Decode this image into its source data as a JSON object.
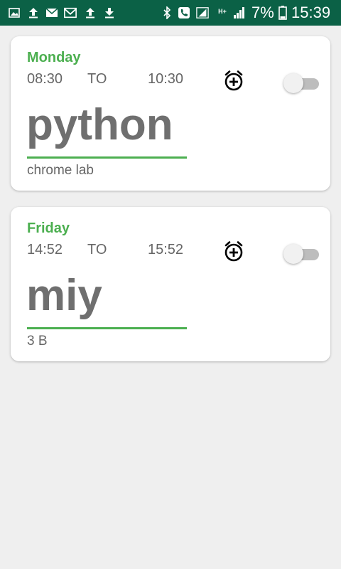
{
  "status_bar": {
    "bg_color": "#0b6146",
    "battery_percent": "7%",
    "time": "15:39",
    "network_type": "H+",
    "icons": [
      "image-icon",
      "upload-icon",
      "email-icon",
      "gmail-icon",
      "upload-icon",
      "download-icon",
      "bluetooth-icon",
      "call-icon",
      "signal-icon",
      "signal-icon",
      "battery-icon"
    ]
  },
  "accent_color": "#4caf50",
  "schedules": [
    {
      "day": "Monday",
      "start": "08:30",
      "to_label": "TO",
      "end": "10:30",
      "subject": "python",
      "room": "chrome lab",
      "enabled": false
    },
    {
      "day": "Friday",
      "start": "14:52",
      "to_label": "TO",
      "end": "15:52",
      "subject": "miy",
      "room": "3 B",
      "enabled": false
    }
  ]
}
